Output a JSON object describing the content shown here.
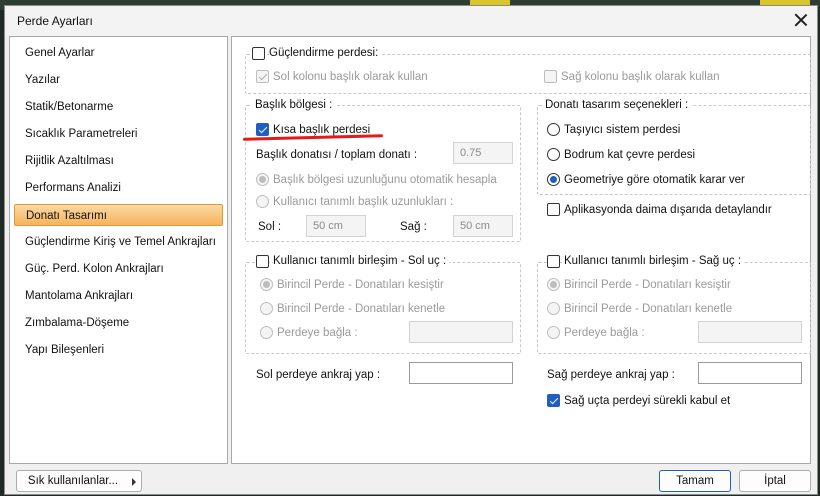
{
  "window": {
    "title": "Perde Ayarları"
  },
  "sidebar": {
    "items": [
      {
        "label": "Genel Ayarlar"
      },
      {
        "label": "Yazılar"
      },
      {
        "label": "Statik/Betonarme"
      },
      {
        "label": "Sıcaklık Parametreleri"
      },
      {
        "label": "Rijitlik Azaltılması"
      },
      {
        "label": "Performans Analizi"
      },
      {
        "label": "Donatı Tasarımı"
      },
      {
        "label": "Güçlendirme Kiriş ve Temel Ankrajları"
      },
      {
        "label": "Güç. Perd. Kolon Ankrajları"
      },
      {
        "label": "Mantolama Ankrajları"
      },
      {
        "label": "Zımbalama-Döşeme"
      },
      {
        "label": "Yapı Bileşenleri"
      }
    ],
    "active_item": "Donatı Tasarımı"
  },
  "guclendirme": {
    "title": "Güçlendirme perdesi:",
    "sol_kolonu": "Sol kolonu başlık olarak kullan",
    "sag_kolonu": "Sağ kolonu başlık olarak kullan"
  },
  "baslik": {
    "title": "Başlık bölgesi :",
    "kisa": "Kısa başlık perdesi",
    "ratio_label": "Başlık donatısı / toplam donatı :",
    "ratio_value": "0.75",
    "otomatik": "Başlık bölgesi uzunluğunu otomatik hesapla",
    "kullanici": "Kullanıcı tanımlı başlık uzunlukları :",
    "sol_label": "Sol :",
    "sol_value": "50 cm",
    "sag_label": "Sağ :",
    "sag_value": "50 cm"
  },
  "donati": {
    "title": "Donatı tasarım seçenekleri :",
    "options": [
      "Taşıyıcı sistem perdesi",
      "Bodrum kat çevre perdesi",
      "Geometriye göre otomatik karar ver"
    ],
    "selected": "Geometriye göre otomatik karar ver",
    "aplikasyon": "Aplikasyonda daima dışarıda detaylandır"
  },
  "sol_uc": {
    "title": "Kullanıcı tanımlı birleşim - Sol uç :",
    "options": [
      "Birincil Perde - Donatıları kesiştir",
      "Birincil Perde - Donatıları kenetle",
      "Perdeye bağla :"
    ]
  },
  "sag_uc": {
    "title": "Kullanıcı tanımlı birleşim - Sağ uç :",
    "options": [
      "Birincil Perde - Donatıları kesiştir",
      "Birincil Perde - Donatıları kenetle",
      "Perdeye bağla :"
    ]
  },
  "ankraj": {
    "sol_label": "Sol perdeye ankraj yap :",
    "sag_label": "Sağ perdeye ankraj yap :",
    "surekli": "Sağ uçta perdeyi sürekli kabul et"
  },
  "footer": {
    "sik": "Sık kullanılanlar...",
    "tamam": "Tamam",
    "iptal": "İptal"
  },
  "colors": {
    "accent": "#1e5fbf",
    "active_item": "#f5b45c",
    "annotation": "#e41b1b"
  }
}
